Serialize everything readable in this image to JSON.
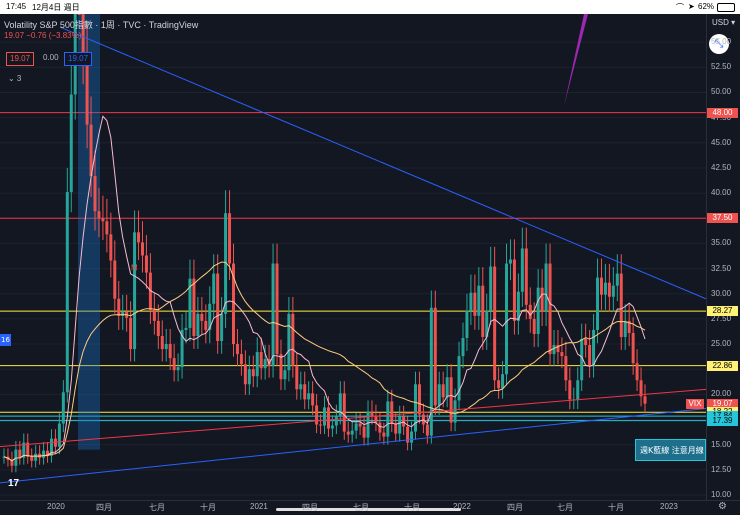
{
  "status": {
    "time": "17:45",
    "date": "12月4日 週日",
    "battery": "62%"
  },
  "legend": {
    "title": "Volatility S&P 500指數 · 1周 · TVC · TradingView",
    "ohlc": "19.07  −0.76 (−3.83%)",
    "box_left": "19.07",
    "box_mid": "0.00",
    "box_right": "19.07",
    "collapse_label": "⌄ 3"
  },
  "currency": "USD ▾",
  "left_badge": "16",
  "candle_label": "M",
  "callout": "週K藍線 注意月線",
  "tv_logo": "17",
  "price_ticks": [
    "55.00",
    "52.50",
    "50.00",
    "47.50",
    "45.00",
    "42.50",
    "40.00",
    "37.50",
    "35.00",
    "32.50",
    "30.00",
    "27.50",
    "25.00",
    "22.50",
    "20.00",
    "17.50",
    "15.00",
    "12.50",
    "10.00"
  ],
  "price_tags": [
    {
      "label": "48.00",
      "value": 48.0,
      "bg": "#ef5350",
      "fg": "#ffffff"
    },
    {
      "label": "37.50",
      "value": 37.5,
      "bg": "#ef5350",
      "fg": "#ffffff"
    },
    {
      "label": "28.27",
      "value": 28.27,
      "bg": "#fff176",
      "fg": "#000000"
    },
    {
      "label": "22.86",
      "value": 22.86,
      "bg": "#fff176",
      "fg": "#000000"
    },
    {
      "label": "19.07",
      "value": 19.07,
      "bg": "#ef5350",
      "fg": "#ffffff"
    },
    {
      "label": "18.22",
      "value": 18.22,
      "bg": "#fff176",
      "fg": "#000000"
    },
    {
      "label": "17.84",
      "value": 17.84,
      "bg": "#26c6da",
      "fg": "#000000"
    },
    {
      "label": "17.39",
      "value": 17.39,
      "bg": "#26c6da",
      "fg": "#000000"
    }
  ],
  "vix_tag": "VIX",
  "time_ticks": [
    "2020",
    "四月",
    "七月",
    "十月",
    "2021",
    "四月",
    "七月",
    "十月",
    "2022",
    "四月",
    "七月",
    "十月",
    "2023"
  ],
  "colors": {
    "up": "#26a69a",
    "down": "#ef5350",
    "bg": "#131722",
    "trend": "#2962ff",
    "yellow": "#ffeb3b",
    "red_line": "#f23645"
  },
  "chart_data": {
    "type": "candlestick",
    "ylim": [
      9.5,
      57.8
    ],
    "horizontal_levels": [
      48.0,
      37.5,
      28.27,
      22.86,
      18.22,
      17.84,
      17.39
    ],
    "weekly_close": [
      13.8,
      13.5,
      12.9,
      14.5,
      13.7,
      15.2,
      13.8,
      13.4,
      14.1,
      13.7,
      14.4,
      13.9,
      15.6,
      14.8,
      17.1,
      20.2,
      40.1,
      49.8,
      66.0,
      65.5,
      53.5,
      46.8,
      41.7,
      38.2,
      37.5,
      37.2,
      35.9,
      33.3,
      29.5,
      27.8,
      28.2,
      27.6,
      24.5,
      36.1,
      35.1,
      33.8,
      32.1,
      28.4,
      27.3,
      25.8,
      24.5,
      25.0,
      23.6,
      22.4,
      22.7,
      26.4,
      26.6,
      31.5,
      25.8,
      28.0,
      27.3,
      26.4,
      29.0,
      32.0,
      25.3,
      28.0,
      38.0,
      33.0,
      25.0,
      24.0,
      23.0,
      21.0,
      22.5,
      21.8,
      24.2,
      22.6,
      23.5,
      22.8,
      33.0,
      24.0,
      21.5,
      22.4,
      28.0,
      22.8,
      20.5,
      21.0,
      19.5,
      20.1,
      18.9,
      17.0,
      16.9,
      18.7,
      16.6,
      16.9,
      17.9,
      20.1,
      16.3,
      16.0,
      16.4,
      17.1,
      16.8,
      15.7,
      18.3,
      17.9,
      17.2,
      16.2,
      15.8,
      19.3,
      17.1,
      16.1,
      17.8,
      16.8,
      15.2,
      16.3,
      21.0,
      18.0,
      17.0,
      15.9,
      28.6,
      18.9,
      21.0,
      19.7,
      21.7,
      17.2,
      19.4,
      23.8,
      25.6,
      28.3,
      30.1,
      27.8,
      30.8,
      25.7,
      28.3,
      32.7,
      21.4,
      20.6,
      22.0,
      33.0,
      33.4,
      27.3,
      30.2,
      34.5,
      28.9,
      27.5,
      26.0,
      30.6,
      28.2,
      33.0,
      24.0,
      24.9,
      24.2,
      23.8,
      21.4,
      19.5,
      19.5,
      21.4,
      25.5,
      24.9,
      22.8,
      26.4,
      31.6,
      29.9,
      31.1,
      29.7,
      30.8,
      32.0,
      25.7,
      27.3,
      26.1,
      23.1,
      21.4,
      19.8,
      19.07
    ]
  }
}
